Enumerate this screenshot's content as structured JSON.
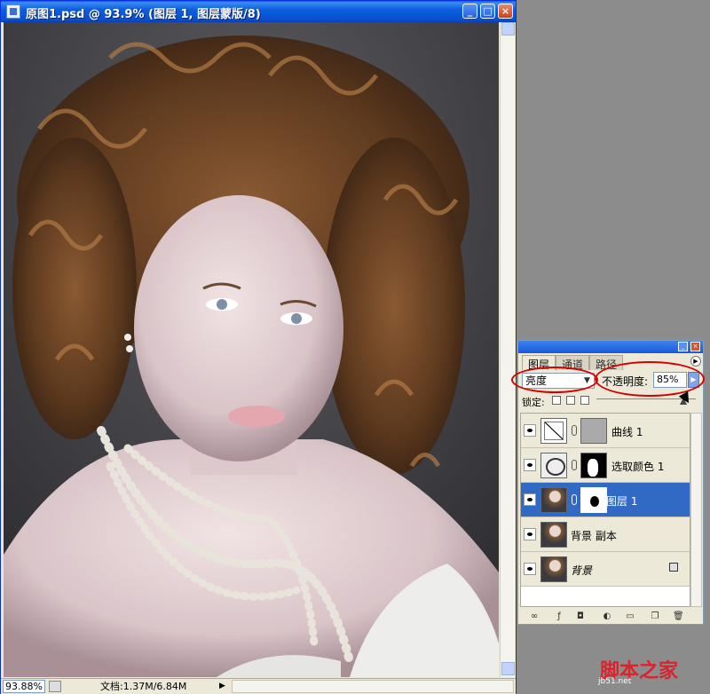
{
  "document_window": {
    "title": "原图1.psd @ 93.9% (图层 1, 图层蒙版/8)",
    "controls": {
      "minimize": "_",
      "maximize": "□",
      "close": "×"
    },
    "status": {
      "zoom": "93.88%",
      "doc_size": "文档:1.37M/6.84M",
      "menu_arrow": "▶"
    }
  },
  "layers_panel": {
    "tabs": [
      {
        "label": "图层"
      },
      {
        "label": "通道"
      },
      {
        "label": "路径"
      }
    ],
    "active_tab": "图层",
    "blend_mode": "亮度",
    "opacity_label": "不透明度:",
    "opacity_value": "85%",
    "lock_label": "锁定:",
    "layers": [
      {
        "name": "曲线 1",
        "type": "curves-adjustment",
        "visible": true,
        "selected": false
      },
      {
        "name": "选取颜色 1",
        "type": "selective-color-adjustment",
        "visible": true,
        "selected": false
      },
      {
        "name": "图层 1",
        "type": "pixel-with-mask",
        "visible": true,
        "selected": true
      },
      {
        "name": "背景 副本",
        "type": "pixel",
        "visible": true,
        "selected": false
      },
      {
        "name": "背景",
        "type": "background-locked",
        "visible": true,
        "selected": false
      }
    ],
    "footer_icons": [
      "link-icon",
      "layer-style-icon",
      "add-mask-icon",
      "adjustment-layer-icon",
      "new-group-icon",
      "new-layer-icon",
      "trash-icon"
    ]
  },
  "annotations": {
    "highlight_color": "#d40000"
  },
  "colors": {
    "selected_layer": "#316ac5",
    "title_bar": "#0b5fe0"
  },
  "watermark": {
    "line1": "脚本之家",
    "line2": "jb51.net"
  }
}
